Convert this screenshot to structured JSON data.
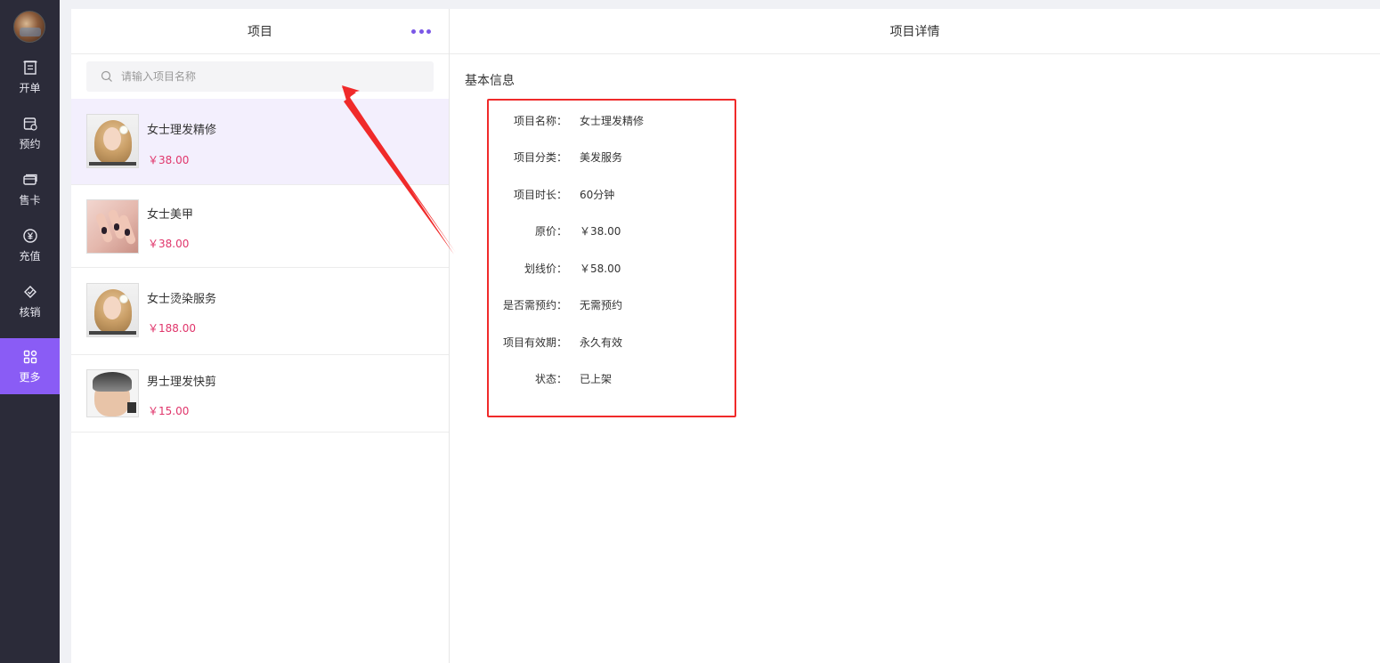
{
  "sidebar": {
    "items": [
      {
        "label": "开单",
        "icon": "order-icon"
      },
      {
        "label": "预约",
        "icon": "calendar-icon"
      },
      {
        "label": "售卡",
        "icon": "card-icon"
      },
      {
        "label": "充值",
        "icon": "yen-icon"
      },
      {
        "label": "核销",
        "icon": "verify-icon"
      },
      {
        "label": "更多",
        "icon": "grid-icon",
        "active": true
      }
    ]
  },
  "list": {
    "title": "项目",
    "search_placeholder": "请输入项目名称",
    "items": [
      {
        "name": "女士理发精修",
        "price": "￥38.00"
      },
      {
        "name": "女士美甲",
        "price": "￥38.00"
      },
      {
        "name": "女士烫染服务",
        "price": "￥188.00"
      },
      {
        "name": "男士理发快剪",
        "price": "￥15.00"
      }
    ]
  },
  "detail": {
    "title": "项目详情",
    "section_title": "基本信息",
    "fields": [
      {
        "label": "项目名称：",
        "value": "女士理发精修"
      },
      {
        "label": "项目分类：",
        "value": "美发服务"
      },
      {
        "label": "项目时长：",
        "value": "60分钟"
      },
      {
        "label": "原价：",
        "value": "￥38.00"
      },
      {
        "label": "划线价：",
        "value": "￥58.00"
      },
      {
        "label": "是否需预约：",
        "value": "无需预约"
      },
      {
        "label": "项目有效期：",
        "value": "永久有效"
      },
      {
        "label": "状态：",
        "value": "已上架"
      }
    ]
  },
  "colors": {
    "sidebar_bg": "#2b2b39",
    "accent": "#8a5cf5",
    "price": "#e0356b",
    "highlight_box": "#f02a2a"
  }
}
